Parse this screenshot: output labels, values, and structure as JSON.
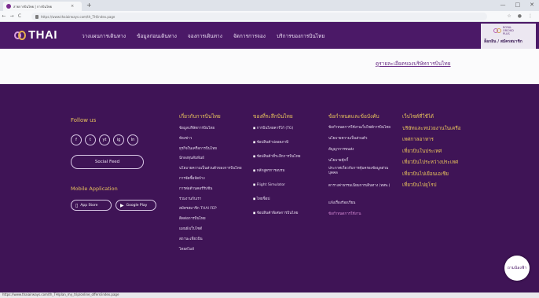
{
  "browser": {
    "tab_title": "สายการบินไทย | การบินไทย",
    "new_tab": "+",
    "tab_close": "×",
    "url": "https://www.thaiairways.com/th_TH/index.page",
    "window_controls": [
      "—",
      "□",
      "✕"
    ],
    "nav_buttons": [
      "←",
      "→",
      "C"
    ],
    "toolbar_icons": [
      "☆",
      "⋮",
      "●"
    ]
  },
  "header": {
    "logo_text": "THAI",
    "nav": [
      "วางแผนการเดินทาง",
      "ข้อมูลก่อนเดินทาง",
      "จองการเดินทาง",
      "จัดการการจอง",
      "บริการของการบินไทย"
    ],
    "member": {
      "program_name": "ROYAL ORCHID PLUS",
      "links": "ล็อกอิน / สมัครสมาชิก"
    }
  },
  "content": {
    "link": "ดูรายละเอียดของบริษัทการบินไทย"
  },
  "footer": {
    "follow_title": "Follow us",
    "social_icons": [
      "f",
      "t",
      "yt",
      "ig",
      "ln"
    ],
    "social_feed_label": "Social Feed",
    "mobile_title": "Mobile Application",
    "app_store_label": "App Store",
    "google_play_label": "Google Play",
    "col1": {
      "title": "เกี่ยวกับการบินไทย",
      "items": [
        "ข้อมูลบริษัทการบินไทย",
        "ห้องข่าว",
        "ธุรกิจในเครือการบินไทย",
        "นักลงทุนสัมพันธ์",
        "นโยบายความเป็นส่วนตัวของการบินไทย",
        "การจัดซื้อจัดจ้าง",
        "การต่อต้านคอร์รัปชัน",
        "ร่วมงานกับเรา",
        "สมัครสมาชิก THAI FEP",
        "ติดต่อการบินไทย",
        "แผนผังเว็บไซต์",
        "สถานะเที่ยวบิน",
        "ไทยสไมล์"
      ]
    },
    "col2": {
      "title": "ของที่ระลึกบินไทย",
      "items": [
        "การบินไทยคาร์โก้ (TG)",
        "ช้อปสินค้าปลอดภาษี",
        "ช้อปสินค้าที่ระลึกการบินไทย",
        "หลักสูตรการอบรม",
        "Flight Simulator",
        "ไทยช็อป",
        "ช้อปสินค้าพิเศษการบินไทย"
      ]
    },
    "col3": {
      "title": "ข้อกำหนดและข้อบังคับ",
      "items": [
        "ข้อกำหนดการใช้งานเว็บไซต์การบินไทย",
        "นโยบายความเป็นส่วนตัว",
        "สัญญาการขนส่ง",
        "นโยบายคุ้กกี้",
        "ประกาศเกี่ยวกับการคุ้มครองข้อมูลส่วนบุคคล",
        "ตารางค่าธรรมเนียมการเดินทาง (ทสพ.)",
        "แจ้งเรื่องร้องเรียน",
        "ข้อกำหนดการใช้งาน"
      ]
    },
    "col4": {
      "title": "เว็บไซต์ที่ใช้ได้",
      "items": [
        "บริษัทและหน่วยงานในเครือ",
        "เทศกาลอาหาร",
        "เที่ยวบินในประเทศ",
        "เที่ยวบินไประหว่างประเทศ",
        "เที่ยวบินไปเยือนเอเชีย",
        "เที่ยวบินไปยุโรป"
      ]
    },
    "chat_label": "ถามน้องฟ้า"
  },
  "status_bar": {
    "url": "https://www.thaiairways.com/th_TH/plan_my_trip/online_offers/index.page"
  },
  "colors": {
    "header_bg": "#4b1967",
    "footer_bg": "#3f1456",
    "accent_gold": "#e8c35c",
    "link_purple": "#6a2d86"
  }
}
